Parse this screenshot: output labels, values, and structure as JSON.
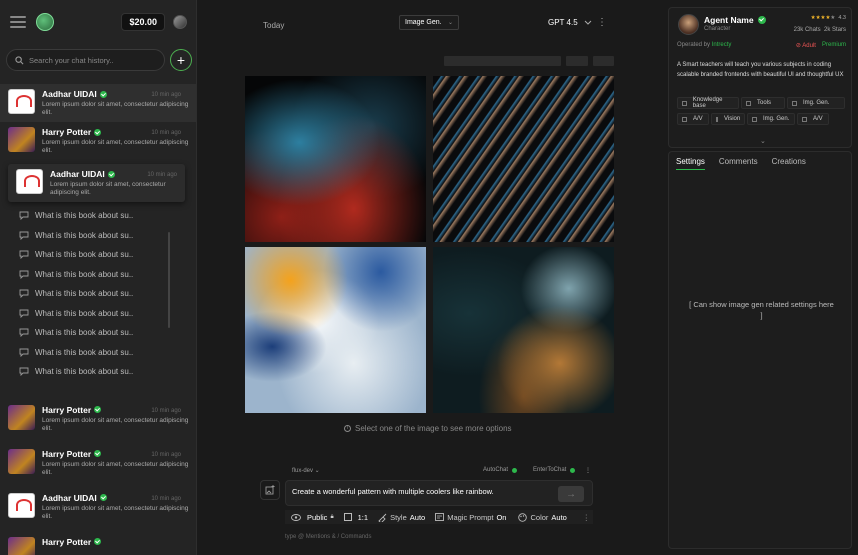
{
  "sidebar": {
    "credit": "$20.00",
    "search_placeholder": "Search your chat history..",
    "chats": [
      {
        "name": "Aadhar UIDAI",
        "desc": "Lorem ipsum dolor sit amet, consectetur adipiscing elit.",
        "time": "10 min ago",
        "thumb": "aadhar"
      },
      {
        "name": "Harry Potter",
        "desc": "Lorem ipsum dolor sit amet, consectetur adipiscing elit.",
        "time": "10 min ago",
        "thumb": "hp"
      },
      {
        "name": "Aadhar UIDAI",
        "desc": "Lorem ipsum dolor sit amet, consectetur adipiscing elit.",
        "time": "10 min ago",
        "thumb": "aadhar"
      }
    ],
    "questions": [
      "What is this book about su..",
      "What is this book about su..",
      "What is this book about su..",
      "What is this book about su..",
      "What is this book about su..",
      "What is this book about su..",
      "What is this book about su..",
      "What is this book about su..",
      "What is this book about su.."
    ],
    "chats2": [
      {
        "name": "Harry Potter",
        "desc": "Lorem ipsum dolor sit amet, consectetur adipiscing elit.",
        "time": "10 min ago",
        "thumb": "hp"
      },
      {
        "name": "Harry Potter",
        "desc": "Lorem ipsum dolor sit amet, consectetur adipiscing elit.",
        "time": "10 min ago",
        "thumb": "hp"
      },
      {
        "name": "Aadhar UIDAI",
        "desc": "Lorem ipsum dolor sit amet, consectetur adipiscing elit.",
        "time": "10 min ago",
        "thumb": "aadhar"
      },
      {
        "name": "Harry Potter",
        "desc": "",
        "time": "",
        "thumb": "hp"
      }
    ]
  },
  "main": {
    "date_label": "Today",
    "mode": "Image Gen.",
    "model": "GPT 4.5",
    "hint": "Select one of the image to see more options",
    "composer": {
      "engine": "flux-dev",
      "toggle1": "AutoChat",
      "toggle2": "EnterToChat",
      "prompt": "Create a wonderful pattern with multiple coolers like rainbow.",
      "tools": {
        "visibility_label": "Public",
        "ratio": "1:1",
        "style_label": "Style",
        "style_value": "Auto",
        "magic_label": "Magic Prompt",
        "magic_value": "On",
        "color_label": "Color",
        "color_value": "Auto"
      },
      "footer": "type @ Mentions & / Commands"
    }
  },
  "agent": {
    "name": "Agent Name",
    "role": "Character",
    "rating": "4.3",
    "chats": "23k Chats",
    "stars": "2k Stars",
    "operated_prefix": "Operated by",
    "operated_by": "Intrecty",
    "adult": "Adult",
    "premium": "Premium",
    "description": "A Smart teachers will teach you various subjects in coding scalable branded frontends with beautiful UI and thoughtful UX",
    "features": [
      "Knowledge base",
      "Tools",
      "Img. Gen.",
      "A/V",
      "Vision",
      "Img. Gen.",
      "A/V"
    ]
  },
  "panel": {
    "tabs": [
      "Settings",
      "Comments",
      "Creations"
    ],
    "placeholder": "[ Can show image gen related settings here ]"
  },
  "colors": {
    "accent": "#2db84c",
    "adult": "#e55555",
    "star": "#f0b429"
  }
}
